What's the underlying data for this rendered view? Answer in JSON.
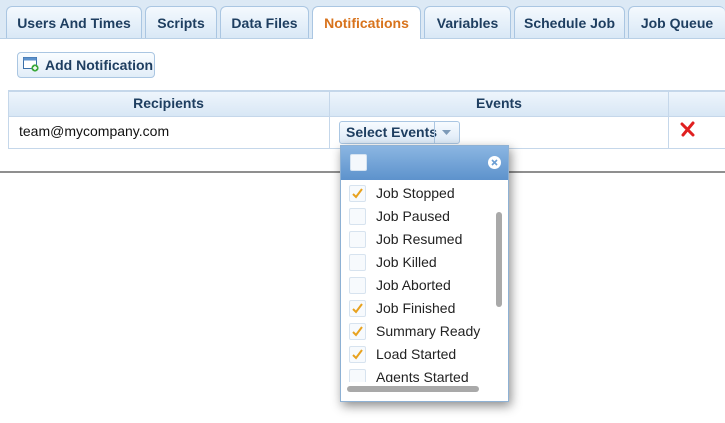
{
  "tabs": [
    {
      "label": "Users And Times",
      "active": false
    },
    {
      "label": "Scripts",
      "active": false
    },
    {
      "label": "Data Files",
      "active": false
    },
    {
      "label": "Notifications",
      "active": true
    },
    {
      "label": "Variables",
      "active": false
    },
    {
      "label": "Schedule Job",
      "active": false
    },
    {
      "label": "Job Queue",
      "active": false
    }
  ],
  "toolbar": {
    "add_label": "Add Notification",
    "add_icon": "add-notification-icon"
  },
  "table": {
    "columns": [
      "Recipients",
      "Events"
    ],
    "rows": [
      {
        "recipient": "team@mycompany.com",
        "events_button": "Select Events",
        "delete_icon": "delete-x-icon"
      }
    ]
  },
  "events_dropdown": {
    "select_all_checked": false,
    "items": [
      {
        "label": "Job Stopped",
        "checked": true
      },
      {
        "label": "Job Paused",
        "checked": false
      },
      {
        "label": "Job Resumed",
        "checked": false
      },
      {
        "label": "Job Killed",
        "checked": false
      },
      {
        "label": "Job Aborted",
        "checked": false
      },
      {
        "label": "Job Finished",
        "checked": true
      },
      {
        "label": "Summary Ready",
        "checked": true
      },
      {
        "label": "Load Started",
        "checked": true
      },
      {
        "label": "Agents Started",
        "checked": false
      }
    ]
  },
  "colors": {
    "active_tab": "#d8731c",
    "tab_text": "#1e3e60",
    "check_mark": "#e8a21f",
    "delete_icon": "#e02020",
    "dropdown_header": "#6d9fd4"
  }
}
